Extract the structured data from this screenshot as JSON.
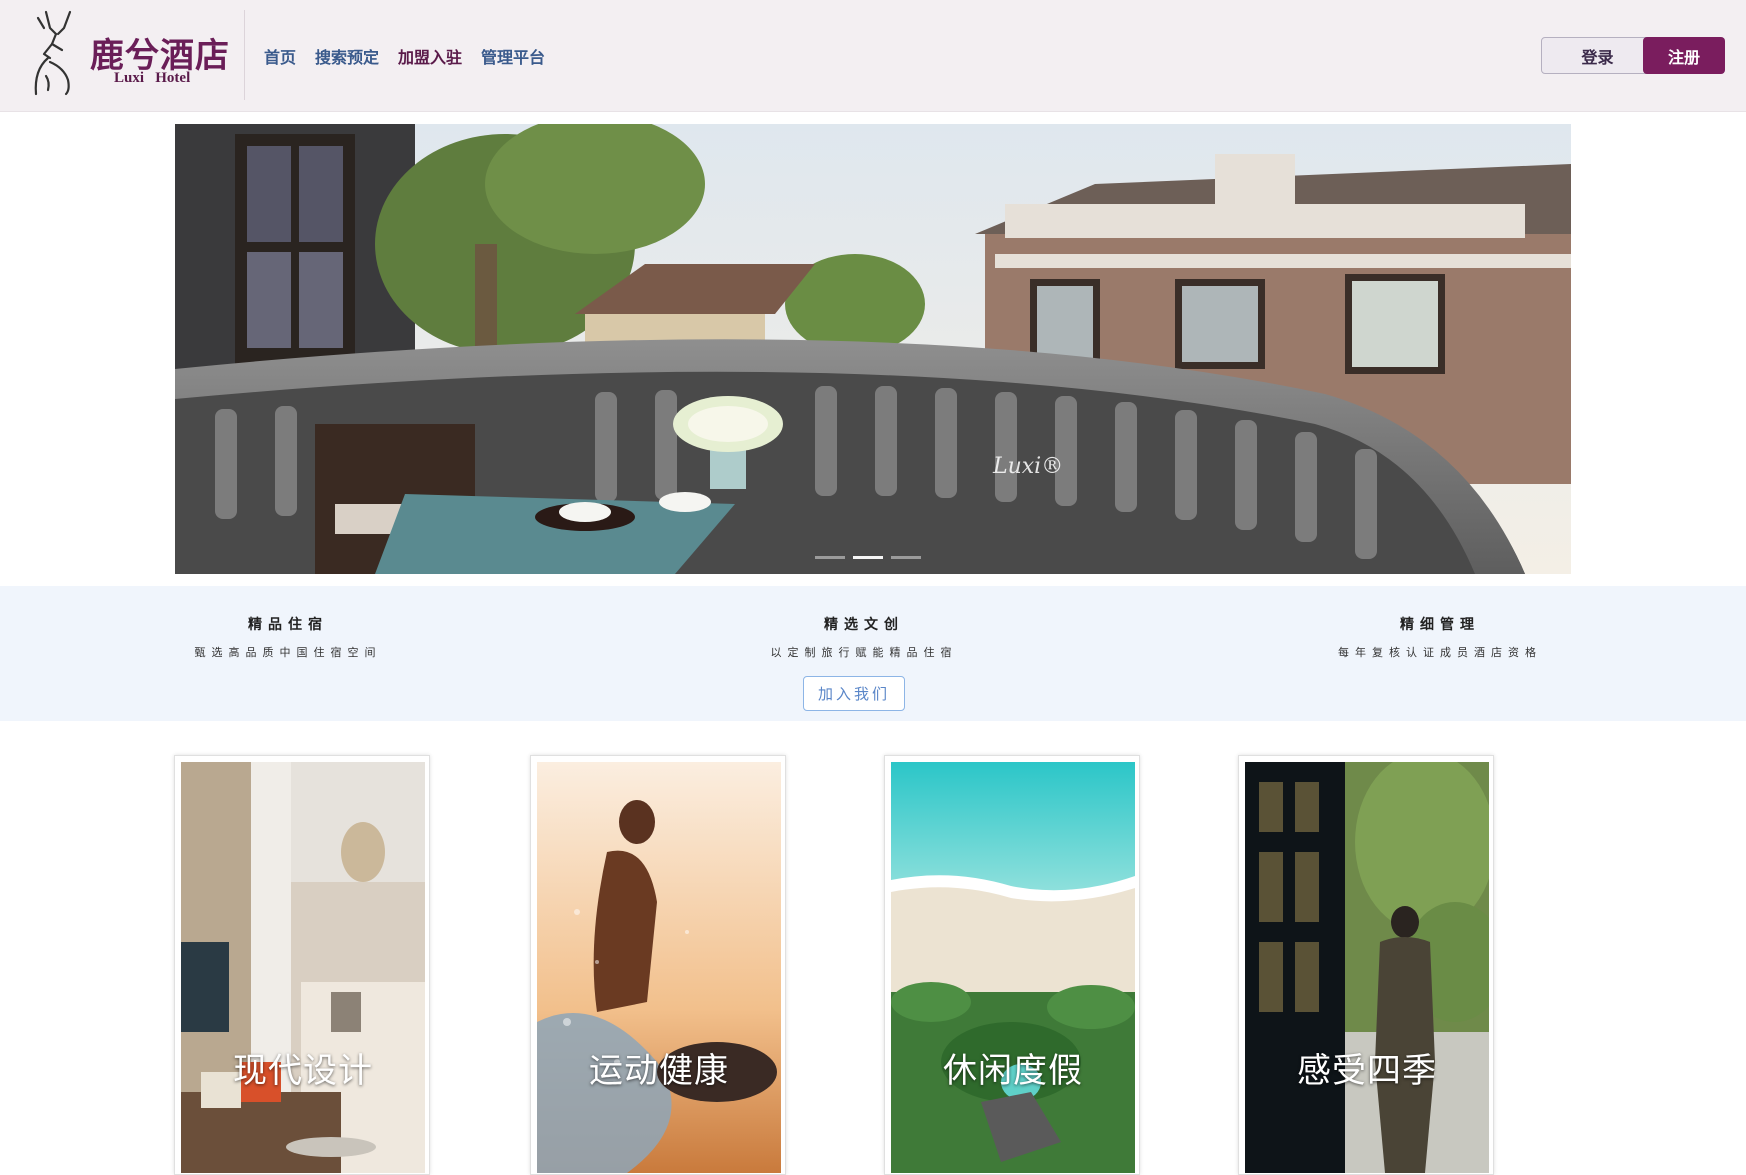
{
  "brand": {
    "name_cn": "鹿兮酒店",
    "name_en": "Luxi   Hotel",
    "logo_icon": "deer-icon",
    "color": "#6a1e58"
  },
  "nav": {
    "items": [
      {
        "label": "首页"
      },
      {
        "label": "搜索预定"
      },
      {
        "label": "加盟入驻"
      },
      {
        "label": "管理平台"
      }
    ]
  },
  "auth": {
    "login_label": "登录",
    "register_label": "注册",
    "register_color": "#7a1d5e"
  },
  "hero": {
    "watermark": "Luxi®",
    "slide_count": 3,
    "active_slide": 2
  },
  "features": {
    "items": [
      {
        "title": "精品住宿",
        "desc": "甄选高品质中国住宿空间"
      },
      {
        "title": "精选文创",
        "desc": "以定制旅行赋能精品住宿"
      },
      {
        "title": "精细管理",
        "desc": "每年复核认证成员酒店资格"
      }
    ],
    "join_label": "加入我们",
    "background": "#f0f5fc"
  },
  "cards": [
    {
      "caption": "现代设计"
    },
    {
      "caption": "运动健康"
    },
    {
      "caption": "休闲度假"
    },
    {
      "caption": "感受四季"
    }
  ]
}
